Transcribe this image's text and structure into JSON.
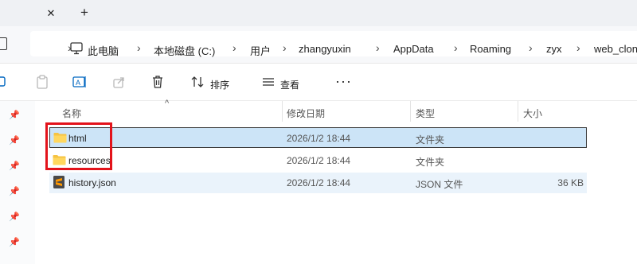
{
  "tabs": {
    "close_label": "✕",
    "add_label": "+"
  },
  "breadcrumb": [
    "此电脑",
    "本地磁盘 (C:)",
    "用户",
    "zhangyuxin",
    "AppData",
    "Roaming",
    "zyx",
    "web_clon"
  ],
  "toolbar": {
    "sort_label": "排序",
    "view_label": "查看",
    "more_label": "···"
  },
  "columns": {
    "name": "名称",
    "modified": "修改日期",
    "type": "类型",
    "size": "大小"
  },
  "files": [
    {
      "name": "html",
      "modified": "2026/1/2 18:44",
      "type": "文件夹",
      "size": "",
      "icon": "folder-icon",
      "state": "selected"
    },
    {
      "name": "resources",
      "modified": "2026/1/2 18:44",
      "type": "文件夹",
      "size": "",
      "icon": "folder-icon",
      "state": "normal"
    },
    {
      "name": "history.json",
      "modified": "2026/1/2 18:44",
      "type": "JSON 文件",
      "size": "36 KB",
      "icon": "sublime-file-icon",
      "state": "hover"
    }
  ],
  "colors": {
    "selection": "#cce4f7",
    "highlight_box": "#e3131b",
    "folder": "#f6c342"
  }
}
